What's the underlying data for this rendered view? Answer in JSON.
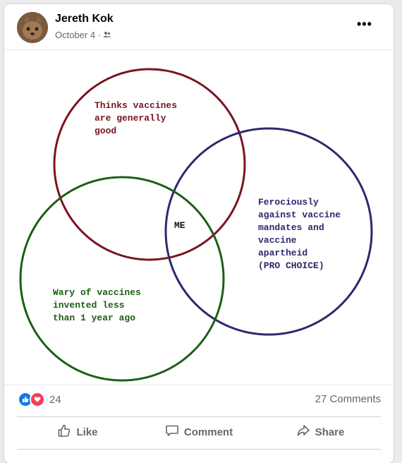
{
  "post": {
    "author": "Jereth Kok",
    "date": "October 4 ·",
    "audience_icon": "friends-icon",
    "menu_icon": "ellipsis-icon",
    "menu_label": "•••"
  },
  "venn": {
    "circles": [
      {
        "name": "red",
        "color": "#7a1420",
        "lines": [
          "Thinks vaccines",
          "are generally",
          "good"
        ]
      },
      {
        "name": "blue",
        "color": "#2b2a6b",
        "lines": [
          "Ferociously",
          "against vaccine",
          "mandates and",
          "vaccine",
          "apartheid",
          "(PRO CHOICE)"
        ]
      },
      {
        "name": "green",
        "color": "#1c5e16",
        "lines": [
          "Wary of vaccines",
          "invented less",
          "than 1 year ago"
        ]
      }
    ],
    "center_label": "ME",
    "center_color": "#111111"
  },
  "reactions": {
    "count": "24",
    "icons": [
      "like-icon",
      "love-icon"
    ],
    "like_color": "#1877f2",
    "love_color": "#f33e58"
  },
  "comments_label": "27 Comments",
  "actions": {
    "like": "Like",
    "comment": "Comment",
    "share": "Share"
  }
}
